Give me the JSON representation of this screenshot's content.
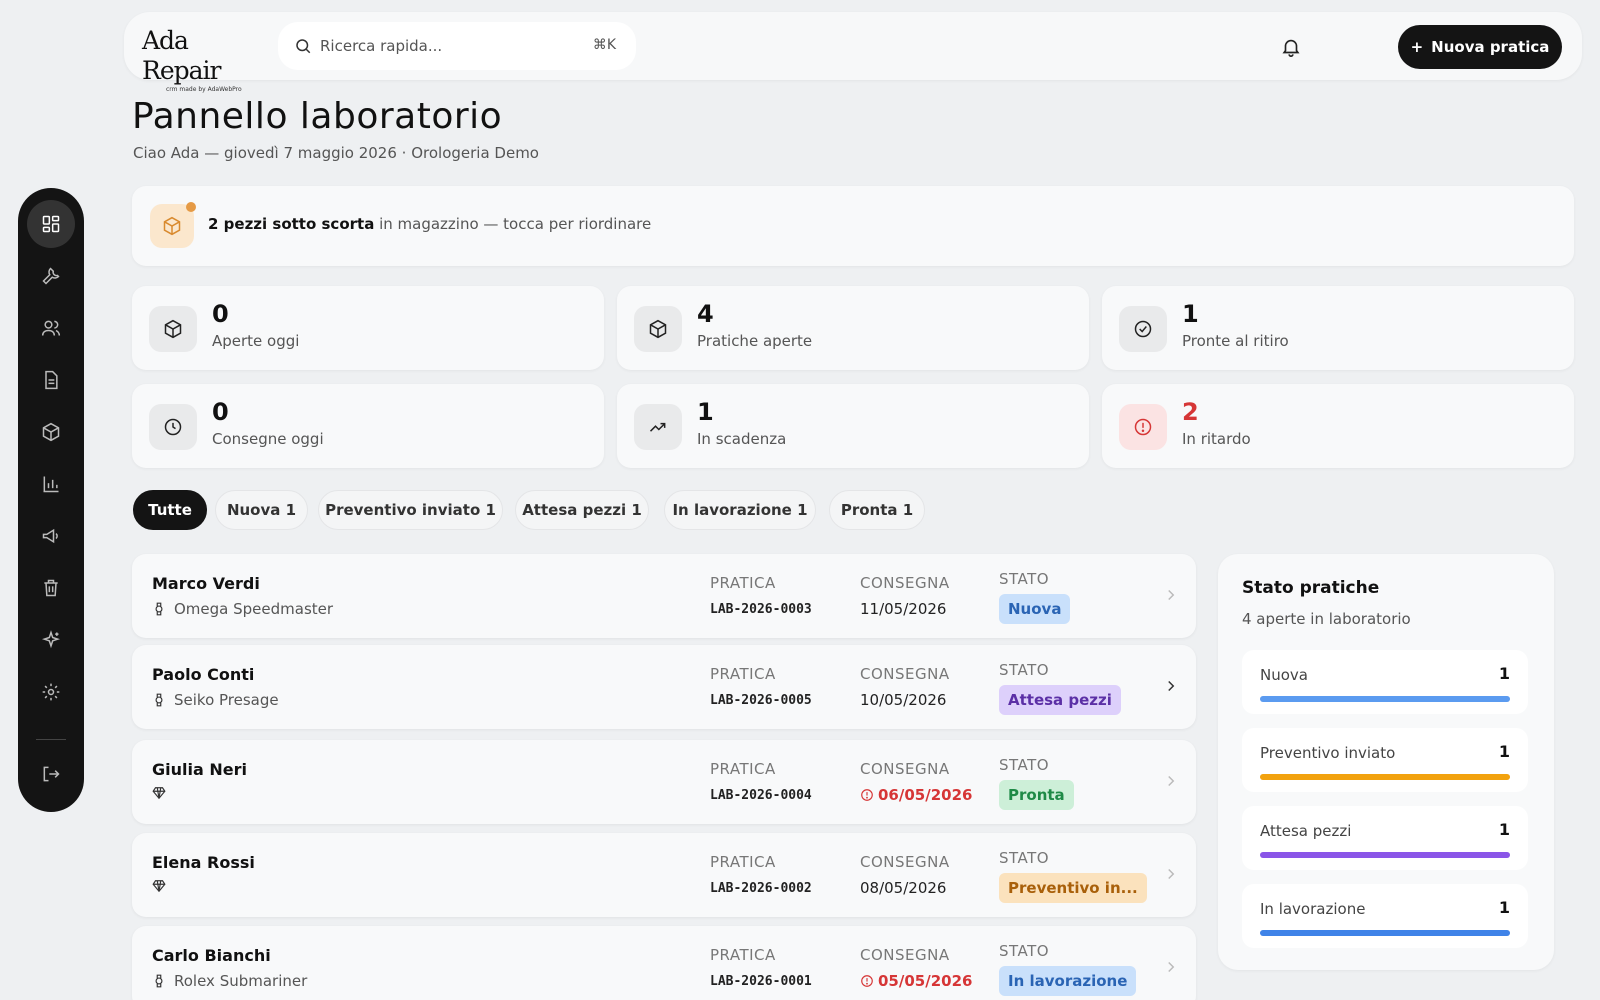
{
  "brand": {
    "name": "Ada Repair",
    "tagline": "crm made by AdaWebPro"
  },
  "search": {
    "placeholder": "Ricerca rapida...",
    "shortcut": "⌘K"
  },
  "header": {
    "new_button": "Nuova pratica"
  },
  "sidebar": {
    "items": [
      {
        "icon": "dashboard-icon",
        "active": true
      },
      {
        "icon": "wrench-icon"
      },
      {
        "icon": "users-icon"
      },
      {
        "icon": "document-icon"
      },
      {
        "icon": "box-icon"
      },
      {
        "icon": "chart-icon"
      },
      {
        "icon": "megaphone-icon"
      },
      {
        "icon": "trash-icon"
      },
      {
        "icon": "sparkle-icon"
      },
      {
        "icon": "gear-icon"
      },
      {
        "icon": "logout-icon"
      }
    ]
  },
  "page": {
    "title": "Pannello laboratorio",
    "subtitle": "Ciao Ada — giovedì 7 maggio 2026 · Orologeria Demo"
  },
  "alert": {
    "bold": "2 pezzi sotto scorta",
    "rest": " in magazzino — tocca per riordinare"
  },
  "stats": [
    {
      "value": "0",
      "label": "Aperte oggi",
      "icon": "box-icon"
    },
    {
      "value": "4",
      "label": "Pratiche aperte",
      "icon": "box-icon"
    },
    {
      "value": "1",
      "label": "Pronte al ritiro",
      "icon": "check-circle-icon"
    },
    {
      "value": "0",
      "label": "Consegne oggi",
      "icon": "clock-icon"
    },
    {
      "value": "1",
      "label": "In scadenza",
      "icon": "trend-up-icon"
    },
    {
      "value": "2",
      "label": "In ritardo",
      "icon": "alert-circle-icon",
      "color": "#d63636"
    }
  ],
  "filters": [
    {
      "label": "Tutte",
      "active": true
    },
    {
      "label": "Nuova 1"
    },
    {
      "label": "Preventivo inviato 1"
    },
    {
      "label": "Attesa pezzi 1"
    },
    {
      "label": "In lavorazione 1"
    },
    {
      "label": "Pronta 1"
    }
  ],
  "columns": {
    "ref": "PRATICA",
    "delivery": "CONSEGNA",
    "status": "STATO"
  },
  "rows": [
    {
      "client": "Marco Verdi",
      "model": "Omega Speedmaster",
      "ref": "LAB-2026-0003",
      "delivery": "11/05/2026",
      "late": false,
      "status": "Nuova",
      "status_bg": "#c9e0fb",
      "status_fg": "#2a64b4"
    },
    {
      "client": "Paolo Conti",
      "model": "Seiko Presage",
      "ref": "LAB-2026-0005",
      "delivery": "10/05/2026",
      "late": false,
      "status": "Attesa pezzi",
      "status_bg": "#ddd0fb",
      "status_fg": "#5b2fa6"
    },
    {
      "client": "Giulia Neri",
      "model": "",
      "ref": "LAB-2026-0004",
      "delivery": "06/05/2026",
      "late": true,
      "status": "Pronta",
      "status_bg": "#cdefd8",
      "status_fg": "#1f8a47"
    },
    {
      "client": "Elena Rossi",
      "model": "",
      "ref": "LAB-2026-0002",
      "delivery": "08/05/2026",
      "late": false,
      "status": "Preventivo in...",
      "status_bg": "#fbe2bd",
      "status_fg": "#a9600a"
    },
    {
      "client": "Carlo Bianchi",
      "model": "Rolex Submariner",
      "ref": "LAB-2026-0001",
      "delivery": "05/05/2026",
      "late": true,
      "status": "In lavorazione",
      "status_bg": "#c9e0fb",
      "status_fg": "#2a64b4"
    }
  ],
  "panel": {
    "title": "Stato pratiche",
    "subtitle": "4 aperte in laboratorio",
    "items": [
      {
        "name": "Nuova",
        "count": "1",
        "color": "#5b9bf0",
        "fill": 1.0
      },
      {
        "name": "Preventivo inviato",
        "count": "1",
        "color": "#f2a20e",
        "fill": 1.0
      },
      {
        "name": "Attesa pezzi",
        "count": "1",
        "color": "#8a55e8",
        "fill": 1.0
      },
      {
        "name": "In lavorazione",
        "count": "1",
        "color": "#3f83e8",
        "fill": 1.0
      }
    ]
  }
}
